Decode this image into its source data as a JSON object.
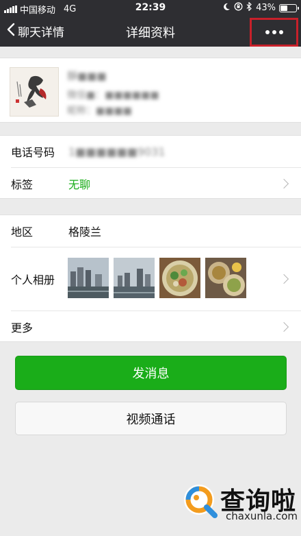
{
  "status_bar": {
    "carrier": "中国移动",
    "network": "4G",
    "time": "22:39",
    "battery": "43%",
    "battery_fraction": 0.43
  },
  "nav": {
    "back_label": "聊天详情",
    "title": "详细资料"
  },
  "profile": {
    "remark_name": "靜■■■",
    "wechat_id": "微信■：■■■■■■",
    "nickname": "昵称：■■■■"
  },
  "contact": {
    "phone_label": "电话号码",
    "phone_value": "1■■■■■■9031",
    "tag_label": "标签",
    "tag_value": "无聊"
  },
  "details": {
    "region_label": "地区",
    "region_value": "格陵兰",
    "album_label": "个人相册",
    "more_label": "更多"
  },
  "actions": {
    "send_message": "发消息",
    "video_call": "视频通话"
  },
  "watermark": {
    "brand": "查询啦",
    "url": "chaxunla.com"
  },
  "colors": {
    "nav_bg": "#2e2e32",
    "accent_green": "#1aad19",
    "tag_green": "#1aad19",
    "highlight_red": "#c8202a"
  }
}
